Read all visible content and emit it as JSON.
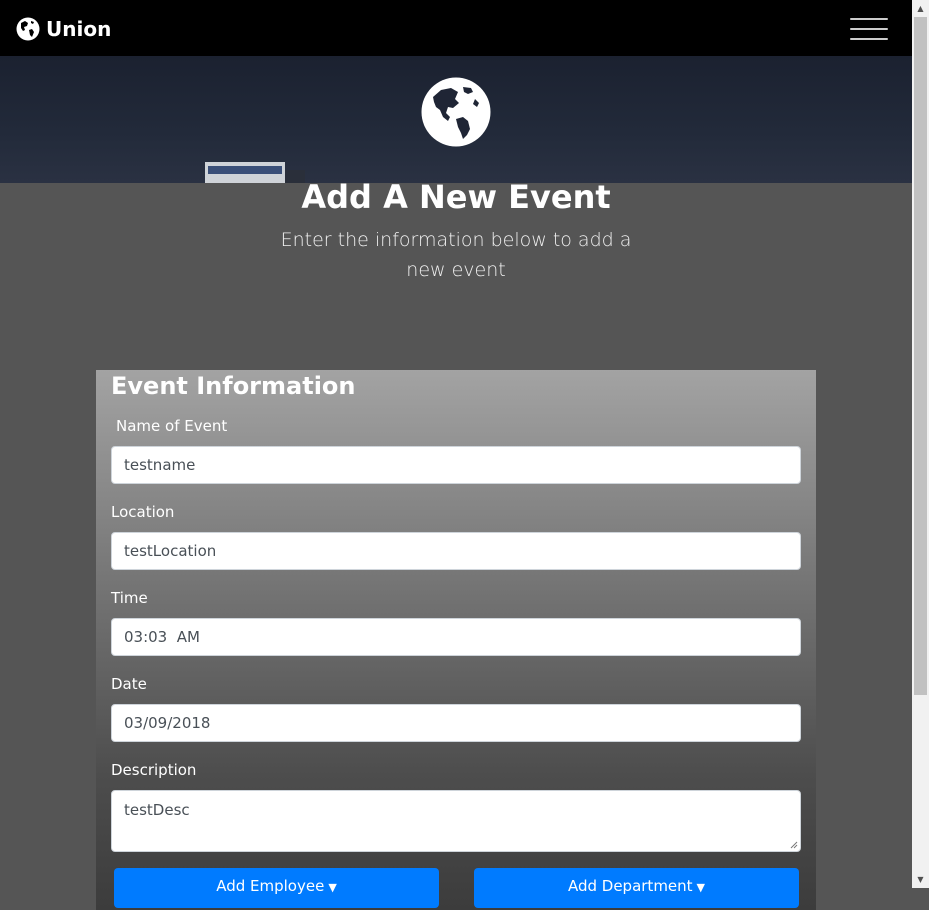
{
  "navbar": {
    "brand": "Union",
    "logo_icon": "globe-icon",
    "menu_icon": "hamburger-menu-icon"
  },
  "hero": {
    "logo_icon": "globe-americas-icon"
  },
  "header": {
    "title": "Add A New Event",
    "subtitle": "Enter the information below to add a new event"
  },
  "form": {
    "title": "Event Information",
    "name_label": "Name of Event",
    "name_value": "testname",
    "location_label": "Location",
    "location_value": "testLocation",
    "time_label": "Time",
    "time_value": "03:03  AM",
    "date_label": "Date",
    "date_value": "03/09/2018",
    "description_label": "Description",
    "description_value": "testDesc",
    "add_employee_label": "Add Employee",
    "add_department_label": "Add Department"
  },
  "colors": {
    "navbar_bg": "#000000",
    "page_bg": "#555555",
    "button_primary": "#007bff"
  }
}
